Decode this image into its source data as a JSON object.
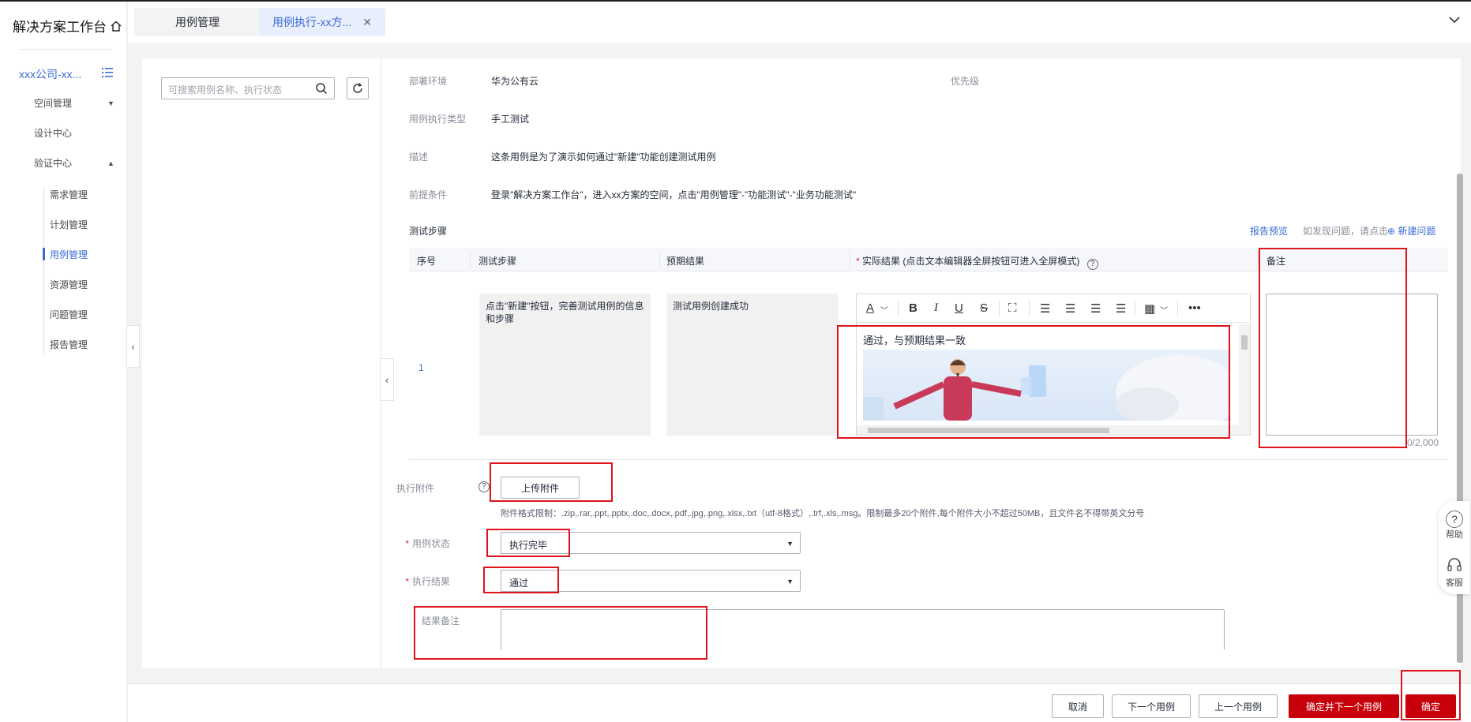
{
  "sidebar": {
    "brand": "解决方案工作台",
    "space": "xxx公司-xx...",
    "nav": {
      "space_mgmt": "空间管理",
      "design_center": "设计中心",
      "verify_center": "验证中心"
    },
    "sub_items": [
      "需求管理",
      "计划管理",
      "用例管理",
      "资源管理",
      "问题管理",
      "报告管理"
    ]
  },
  "tabs": {
    "tab1": "用例管理",
    "tab2": "用例执行-xx方..."
  },
  "search": {
    "placeholder": "可搜索用例名称、执行状态"
  },
  "info": {
    "deploy_env_label": "部署环境",
    "deploy_env_value": "华为公有云",
    "priority_label": "优先级",
    "exec_type_label": "用例执行类型",
    "exec_type_value": "手工测试",
    "desc_label": "描述",
    "desc_value": "这条用例是为了演示如何通过\"新建\"功能创建测试用例",
    "precond_label": "前提条件",
    "precond_value": "登录\"解决方案工作台\"，进入xx方案的空间，点击\"用例管理\"-\"功能测试\"-\"业务功能测试\""
  },
  "steps": {
    "title": "测试步骤",
    "preview_link": "报告预览",
    "issue_hint": "如发现问题，请点击",
    "new_issue": "新建问题",
    "headers": {
      "seq": "序号",
      "step": "测试步骤",
      "expected": "预期结果",
      "actual": "实际结果 (点击文本编辑器全屏按钮可进入全屏模式)",
      "remark": "备注"
    },
    "row": {
      "seq": "1",
      "step": "点击\"新建\"按钮，完善测试用例的信息和步骤",
      "expected": "测试用例创建成功",
      "actual": "通过，与预期结果一致",
      "remark_count": "0/2,000"
    }
  },
  "attach": {
    "label": "执行附件",
    "button": "上传附件",
    "hint": "附件格式限制：.zip,.rar,.ppt,.pptx,.doc,.docx,.pdf,.jpg,.png,.xlsx,.txt（utf-8格式）,.trf,.xls,.msg。限制最多20个附件,每个附件大小不超过50MB，且文件名不得带英文分号"
  },
  "form": {
    "status_label": "用例状态",
    "status_value": "执行完毕",
    "result_label": "执行结果",
    "result_value": "通过",
    "result_remark_label": "结果备注"
  },
  "float_help": {
    "help": "帮助",
    "service": "客服"
  },
  "footer": {
    "cancel": "取消",
    "next": "下一个用例",
    "prev": "上一个用例",
    "confirm_next": "确定并下一个用例",
    "confirm": "确定"
  },
  "colors": {
    "accent": "#3a6ad4",
    "primary_button": "#c7000b",
    "annotation": "#e0121b"
  }
}
